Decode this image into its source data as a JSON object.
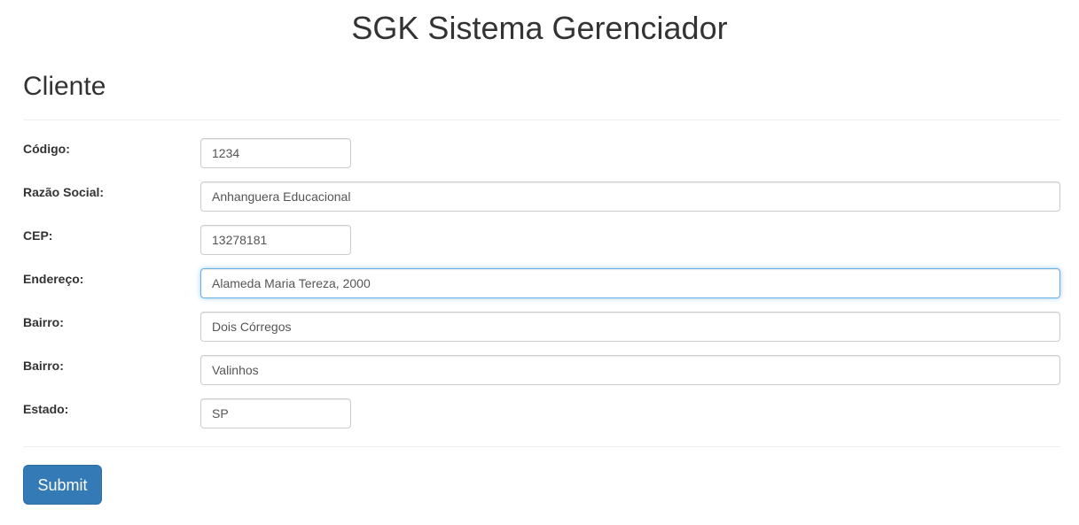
{
  "header": {
    "app_title": "SGK Sistema Gerenciador"
  },
  "form": {
    "title": "Cliente",
    "fields": [
      {
        "label": "Código:",
        "value": "1234"
      },
      {
        "label": "Razão Social:",
        "value": "Anhanguera Educacional"
      },
      {
        "label": "CEP:",
        "value": "13278181"
      },
      {
        "label": "Endereço:",
        "value": "Alameda Maria Tereza, 2000",
        "focused": true
      },
      {
        "label": "Bairro:",
        "value": "Dois Córregos"
      },
      {
        "label": "Bairro:",
        "value": "Valinhos"
      },
      {
        "label": "Estado:",
        "value": "SP"
      }
    ],
    "submit_label": "Submit"
  },
  "colors": {
    "primary": "#337ab7",
    "focus_border": "#66afe9",
    "text": "#333333",
    "input_text": "#555555",
    "input_border": "#cccccc"
  }
}
